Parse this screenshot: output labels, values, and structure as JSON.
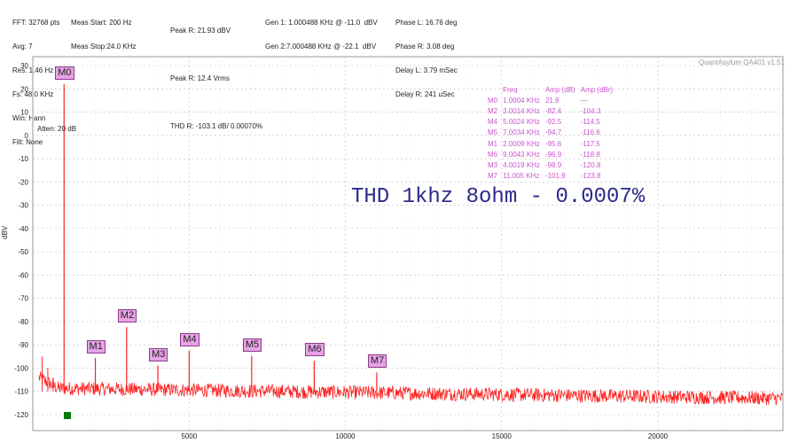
{
  "header": {
    "col1": [
      "FFT: 32768 pts",
      "Avg: 7",
      "Res: 1.46 Hz",
      "Fs: 48.0 KHz",
      "Win: Hann",
      "Filt: None"
    ],
    "col2": [
      "Meas Start: 200 Hz",
      "Meas Stop:24.0 KHz"
    ],
    "col3": [
      "Peak R: 21.93 dBV",
      "",
      "Peak R: 12.4 Vrms",
      "",
      "THD R: -103.1 dB/ 0.00070%"
    ],
    "col4": [
      "Gen 1: 1.000488 KHz @ -11.0  dBV",
      "Gen 2:7.000488 KHz @ -22.1  dBV"
    ],
    "col5": [
      "Phase L: 16.76 deg",
      "Phase R: 3.08 deg",
      "Delay L: 3.79 mSec",
      "Delay R: 241 uSec"
    ]
  },
  "brand": "QuantAsylum QA401 v1.51",
  "atten_label": "Atten: 20 dB",
  "annotation": "THD 1khz 8ohm - 0.0007%",
  "marker_table": {
    "headers": [
      "",
      "Freq",
      "Amp (dB)",
      "Amp (dBr)"
    ],
    "rows": [
      [
        "M0",
        "1.0004 KHz",
        "21.9",
        "---"
      ],
      [
        "M2",
        "3.0014 KHz",
        "-82.4",
        "-104.3"
      ],
      [
        "M4",
        "5.0024 KHz",
        "-92.5",
        "-114.5"
      ],
      [
        "M5",
        "7.0034 KHz",
        "-94.7",
        "-116.6"
      ],
      [
        "M1",
        "2.0009 KHz",
        "-95.6",
        "-117.5"
      ],
      [
        "M6",
        "9.0043 KHz",
        "-96.9",
        "-118.8"
      ],
      [
        "M3",
        "4.0019 KHz",
        "-98.9",
        "-120.8"
      ],
      [
        "M7",
        "11.005 KHz",
        "-101.9",
        "-123.8"
      ]
    ]
  },
  "colors": {
    "trace": "#ff2020",
    "marker_fill": "#e6a3e6",
    "annotation": "#2a2a8a",
    "table_text": "#cc55cc",
    "grid": "#bbbbbb"
  },
  "chart_data": {
    "type": "line",
    "title": "",
    "xlabel": "",
    "ylabel": "dBV",
    "xlim": [
      0,
      24000
    ],
    "ylim": [
      -125,
      35
    ],
    "xticks": [
      5000,
      10000,
      15000,
      20000
    ],
    "yticks": [
      30,
      20,
      10,
      0,
      -10,
      -20,
      -30,
      -40,
      -50,
      -60,
      -70,
      -80,
      -90,
      -100,
      -110,
      -120
    ],
    "grid": true,
    "noise_floor": -110,
    "markers": [
      {
        "name": "M0",
        "x": 1000,
        "y": 21.9
      },
      {
        "name": "M1",
        "x": 2001,
        "y": -95.6
      },
      {
        "name": "M2",
        "x": 3001,
        "y": -82.4
      },
      {
        "name": "M3",
        "x": 4002,
        "y": -98.9
      },
      {
        "name": "M4",
        "x": 5002,
        "y": -92.5
      },
      {
        "name": "M5",
        "x": 7003,
        "y": -94.7
      },
      {
        "name": "M6",
        "x": 9004,
        "y": -96.9
      },
      {
        "name": "M7",
        "x": 11005,
        "y": -101.9
      }
    ]
  }
}
